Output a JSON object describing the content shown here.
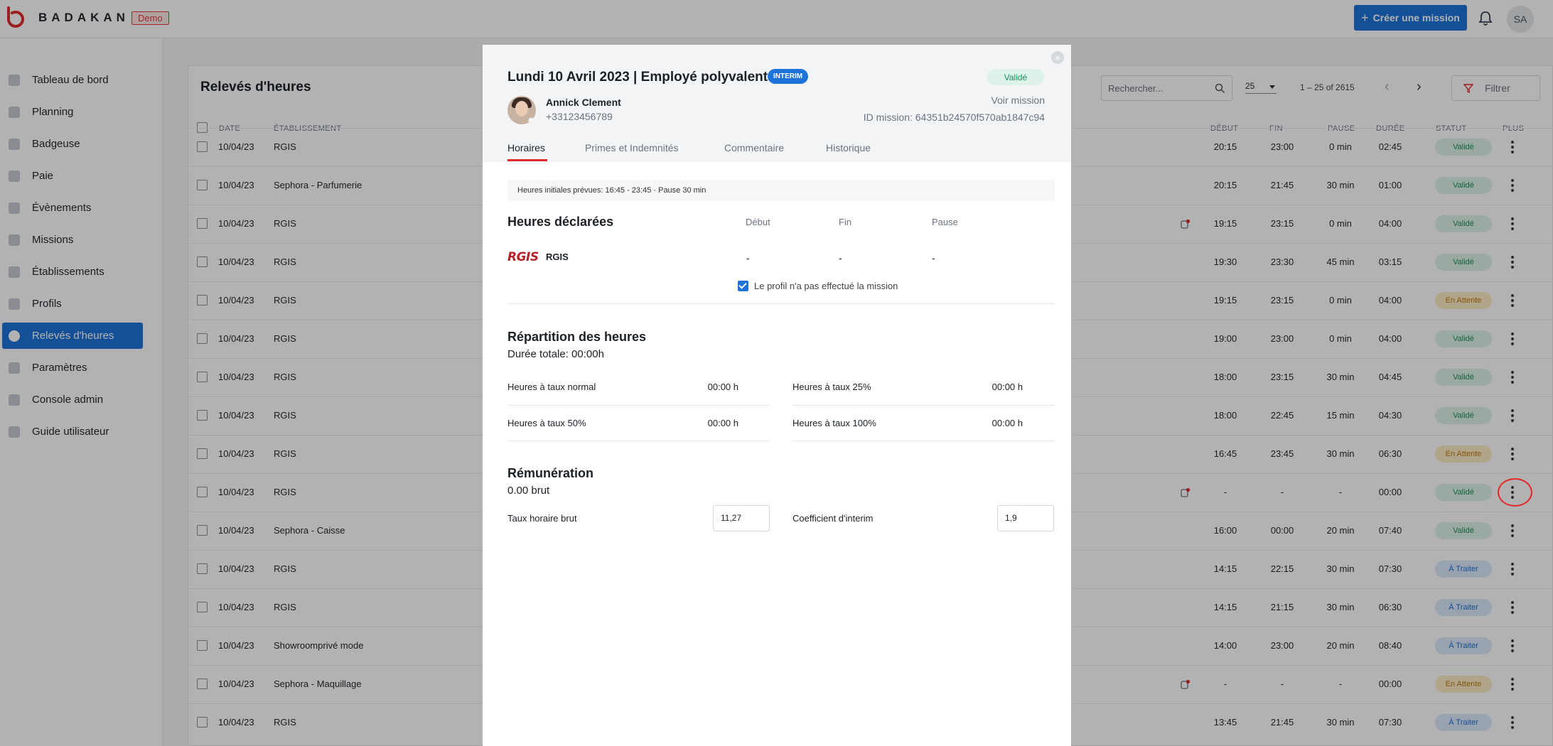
{
  "topbar": {
    "brand": "BADAKAN",
    "demo_badge": "Demo",
    "create_button": "Créer une mission",
    "user_initials": "SA"
  },
  "sidebar": {
    "items": [
      {
        "label": "Tableau de bord",
        "icon": "dashboard-icon"
      },
      {
        "label": "Planning",
        "icon": "calendar-icon"
      },
      {
        "label": "Badgeuse",
        "icon": "hourglass-icon"
      },
      {
        "label": "Paie",
        "icon": "payroll-icon"
      },
      {
        "label": "Évènements",
        "icon": "events-icon"
      },
      {
        "label": "Missions",
        "icon": "missions-icon"
      },
      {
        "label": "Établissements",
        "icon": "location-icon"
      },
      {
        "label": "Profils",
        "icon": "user-icon"
      },
      {
        "label": "Relevés d'heures",
        "icon": "clock-icon",
        "active": true
      },
      {
        "label": "Paramètres",
        "icon": "settings-icon"
      },
      {
        "label": "Console admin",
        "icon": "console-icon"
      },
      {
        "label": "Guide utilisateur",
        "icon": "help-icon"
      }
    ]
  },
  "page": {
    "title": "Relevés d'heures",
    "search_placeholder": "Rechercher...",
    "per_page": "25",
    "range": "1 – 25 of 2615",
    "filter_label": "Filtrer"
  },
  "table": {
    "headers": {
      "date": "DATE",
      "establishment": "ÉTABLISSEMENT",
      "start": "DÉBUT",
      "end": "FIN",
      "pause": "PAUSE",
      "duration": "DURÉE",
      "status": "STATUT",
      "more": "PLUS"
    },
    "rows": [
      {
        "date": "10/04/23",
        "est": "RGIS",
        "start": "20:15",
        "end": "23:00",
        "pause": "0 min",
        "dur": "02:45",
        "status": "Validé",
        "flag": false
      },
      {
        "date": "10/04/23",
        "est": "Sephora - Parfumerie",
        "start": "20:15",
        "end": "21:45",
        "pause": "30 min",
        "dur": "01:00",
        "status": "Validé",
        "flag": false
      },
      {
        "date": "10/04/23",
        "est": "RGIS",
        "start": "19:15",
        "end": "23:15",
        "pause": "0 min",
        "dur": "04:00",
        "status": "Validé",
        "flag": true
      },
      {
        "date": "10/04/23",
        "est": "RGIS",
        "start": "19:30",
        "end": "23:30",
        "pause": "45 min",
        "dur": "03:15",
        "status": "Validé",
        "flag": false
      },
      {
        "date": "10/04/23",
        "est": "RGIS",
        "start": "19:15",
        "end": "23:15",
        "pause": "0 min",
        "dur": "04:00",
        "status": "En Attente",
        "flag": false
      },
      {
        "date": "10/04/23",
        "est": "RGIS",
        "start": "19:00",
        "end": "23:00",
        "pause": "0 min",
        "dur": "04:00",
        "status": "Validé",
        "flag": false
      },
      {
        "date": "10/04/23",
        "est": "RGIS",
        "start": "18:00",
        "end": "23:15",
        "pause": "30 min",
        "dur": "04:45",
        "status": "Validé",
        "flag": false
      },
      {
        "date": "10/04/23",
        "est": "RGIS",
        "start": "18:00",
        "end": "22:45",
        "pause": "15 min",
        "dur": "04:30",
        "status": "Validé",
        "flag": false
      },
      {
        "date": "10/04/23",
        "est": "RGIS",
        "start": "16:45",
        "end": "23:45",
        "pause": "30 min",
        "dur": "06:30",
        "status": "En Attente",
        "flag": false
      },
      {
        "date": "10/04/23",
        "est": "RGIS",
        "start": "-",
        "end": "-",
        "pause": "-",
        "dur": "00:00",
        "status": "Validé",
        "flag": true
      },
      {
        "date": "10/04/23",
        "est": "Sephora - Caisse",
        "start": "16:00",
        "end": "00:00",
        "pause": "20 min",
        "dur": "07:40",
        "status": "Validé",
        "flag": false
      },
      {
        "date": "10/04/23",
        "est": "RGIS",
        "start": "14:15",
        "end": "22:15",
        "pause": "30 min",
        "dur": "07:30",
        "status": "À Traiter",
        "flag": false
      },
      {
        "date": "10/04/23",
        "est": "RGIS",
        "start": "14:15",
        "end": "21:15",
        "pause": "30 min",
        "dur": "06:30",
        "status": "À Traiter",
        "flag": false
      },
      {
        "date": "10/04/23",
        "est": "Showroomprivé mode",
        "start": "14:00",
        "end": "23:00",
        "pause": "20 min",
        "dur": "08:40",
        "status": "À Traiter",
        "flag": false
      },
      {
        "date": "10/04/23",
        "est": "Sephora - Maquillage",
        "start": "-",
        "end": "-",
        "pause": "-",
        "dur": "00:00",
        "status": "En Attente",
        "flag": true
      },
      {
        "date": "10/04/23",
        "est": "RGIS",
        "start": "13:45",
        "end": "21:45",
        "pause": "30 min",
        "dur": "07:30",
        "status": "À Traiter",
        "flag": false
      }
    ]
  },
  "modal": {
    "title": "Lundi 10 Avril 2023 | Employé polyvalent",
    "type_badge": "INTERIM",
    "status": "Validé",
    "person_name": "Annick Clement",
    "person_phone": "+33123456789",
    "voir_mission": "Voir mission",
    "mission_id": "ID mission: 64351b24570f570ab1847c94",
    "tabs": [
      "Horaires",
      "Primes et Indemnités",
      "Commentaire",
      "Historique"
    ],
    "initial_hours": "Heures initiales prévues: 16:45 - 23:45 · Pause 30 min",
    "declared": {
      "title": "Heures déclarées",
      "col_start": "Début",
      "col_end": "Fin",
      "col_pause": "Pause",
      "company_logo": "RGIS",
      "company_name": "RGIS",
      "start": "-",
      "end": "-",
      "pause": "-",
      "not_done_label": "Le profil n'a pas effectué la mission"
    },
    "repartition": {
      "title": "Répartition des heures",
      "total": "Durée totale: 00:00h",
      "items": [
        {
          "label": "Heures à taux normal",
          "value": "00:00 h"
        },
        {
          "label": "Heures à taux 25%",
          "value": "00:00 h"
        },
        {
          "label": "Heures à taux 50%",
          "value": "00:00 h"
        },
        {
          "label": "Heures à taux 100%",
          "value": "00:00 h"
        }
      ]
    },
    "remuneration": {
      "title": "Rémunération",
      "gross": "0.00 brut",
      "hourly_label": "Taux horaire brut",
      "hourly_value": "11,27",
      "coef_label": "Coefficient d'interim",
      "coef_value": "1,9"
    }
  },
  "colors": {
    "primary": "#1e73d8",
    "validated_bg": "#ddf3e9",
    "validated_fg": "#1b8e5a",
    "pending_bg": "#fcebc8",
    "pending_fg": "#b9780c",
    "todo_bg": "#dbe9fb",
    "todo_fg": "#1e6fd1",
    "accent_red": "#e32a2a"
  }
}
